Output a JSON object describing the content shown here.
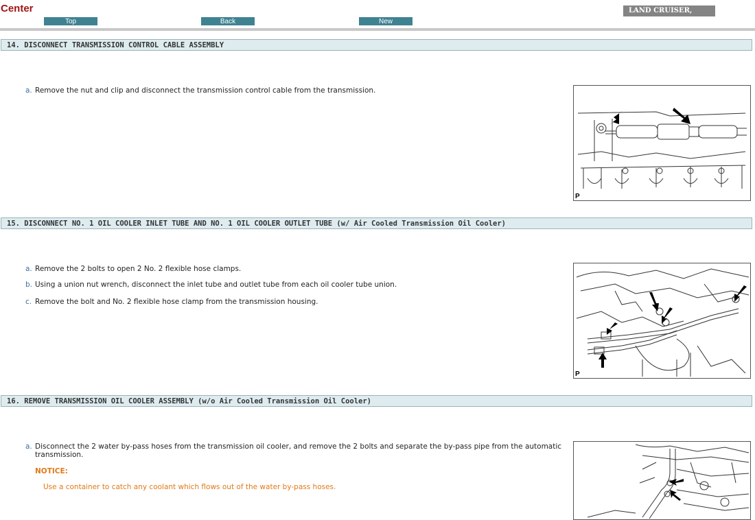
{
  "header": {
    "title": "Center",
    "nav": {
      "top": "Top",
      "back": "Back",
      "new": "New"
    },
    "model": "LAND CRUISER,"
  },
  "sections": [
    {
      "heading": "14. DISCONNECT TRANSMISSION CONTROL CABLE ASSEMBLY",
      "steps": [
        {
          "letter": "a.",
          "text": "Remove the nut and clip and disconnect the transmission control cable from the transmission."
        }
      ],
      "figure_label": "P"
    },
    {
      "heading": "15. DISCONNECT NO. 1 OIL COOLER INLET TUBE AND NO. 1 OIL COOLER OUTLET TUBE (w/ Air Cooled Transmission Oil Cooler)",
      "steps": [
        {
          "letter": "a.",
          "text": "Remove the 2 bolts to open 2 No. 2 flexible hose clamps."
        },
        {
          "letter": "b.",
          "text": "Using a union nut wrench, disconnect the inlet tube and outlet tube from each oil cooler tube union."
        },
        {
          "letter": "c.",
          "text": "Remove the bolt and No. 2 flexible hose clamp from the transmission housing."
        }
      ],
      "figure_label": "P"
    },
    {
      "heading": "16. REMOVE TRANSMISSION OIL COOLER ASSEMBLY (w/o Air Cooled Transmission Oil Cooler)",
      "steps": [
        {
          "letter": "a.",
          "text": "Disconnect the 2 water by-pass hoses from the transmission oil cooler, and remove the 2 bolts and separate the by-pass pipe from the automatic transmission."
        }
      ],
      "notice": {
        "label": "NOTICE:",
        "text": "Use a container to catch any coolant which flows out of the water by-pass hoses."
      }
    }
  ],
  "colors": {
    "title": "#a01414",
    "nav_button": "#3f8291",
    "model_badge": "#848484",
    "section_bar": "#deecef",
    "notice": "#e07a18"
  }
}
